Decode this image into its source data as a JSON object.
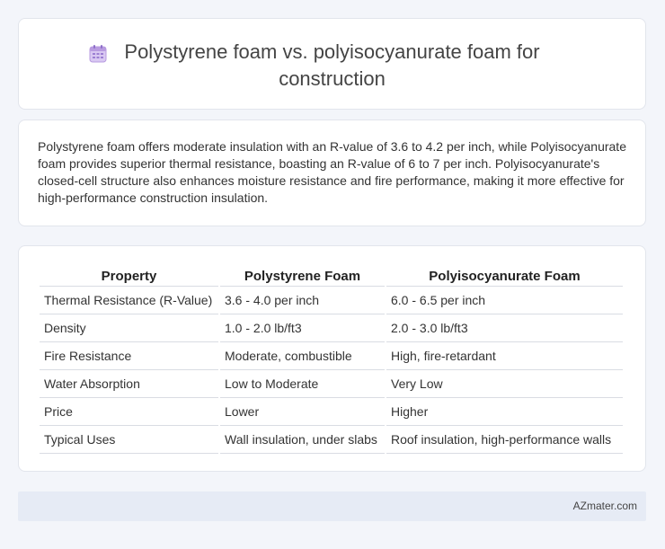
{
  "title": "Polystyrene foam vs. polyisocyanurate foam for construction",
  "title_icon": "calendar-icon",
  "summary": "Polystyrene foam offers moderate insulation with an R-value of 3.6 to 4.2 per inch, while Polyisocyanurate foam provides superior thermal resistance, boasting an R-value of 6 to 7 per inch. Polyisocyanurate's closed-cell structure also enhances moisture resistance and fire performance, making it more effective for high-performance construction insulation.",
  "table": {
    "headers": [
      "Property",
      "Polystyrene Foam",
      "Polyisocyanurate Foam"
    ],
    "rows": [
      [
        "Thermal Resistance (R-Value)",
        "3.6 - 4.0 per inch",
        "6.0 - 6.5 per inch"
      ],
      [
        "Density",
        "1.0 - 2.0 lb/ft3",
        "2.0 - 3.0 lb/ft3"
      ],
      [
        "Fire Resistance",
        "Moderate, combustible",
        "High, fire-retardant"
      ],
      [
        "Water Absorption",
        "Low to Moderate",
        "Very Low"
      ],
      [
        "Price",
        "Lower",
        "Higher"
      ],
      [
        "Typical Uses",
        "Wall insulation, under slabs",
        "Roof insulation, high-performance walls"
      ]
    ]
  },
  "footer": "AZmater.com"
}
